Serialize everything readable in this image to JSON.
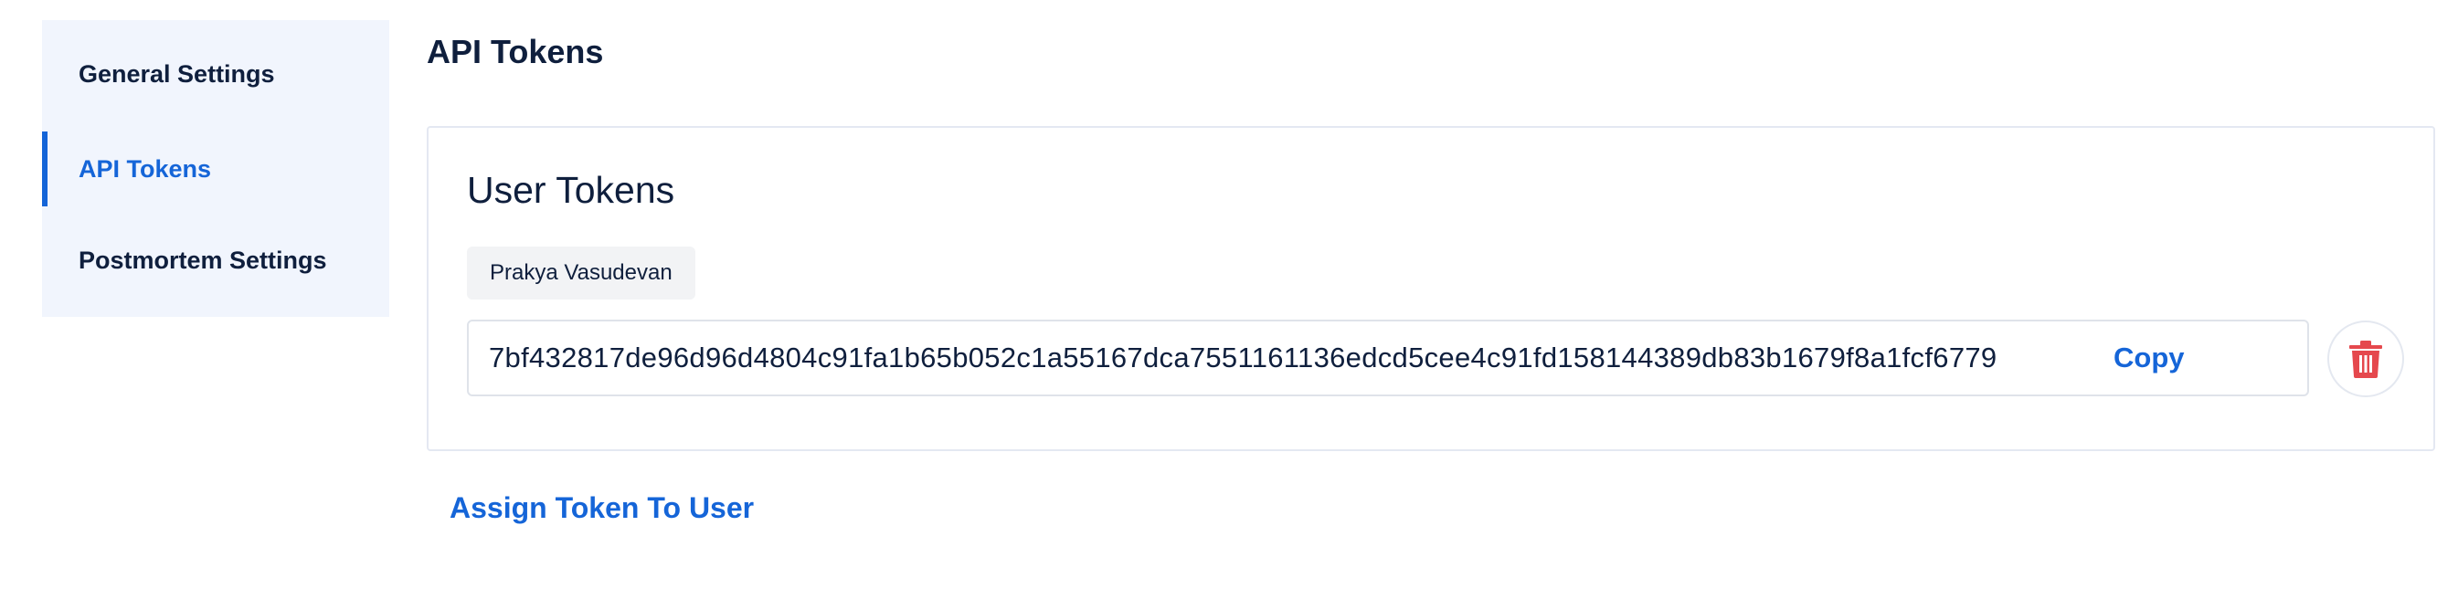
{
  "sidebar": {
    "items": [
      {
        "label": "General Settings",
        "active": false
      },
      {
        "label": "API Tokens",
        "active": true
      },
      {
        "label": "Postmortem Settings",
        "active": false
      }
    ]
  },
  "main": {
    "title": "API Tokens",
    "card": {
      "title": "User Tokens",
      "user_name": "Prakya Vasudevan",
      "token_value": "7bf432817de96d96d4804c91fa1b65b052c1a55167dca7551161136edcd5cee4c91fd158144389db83b1679f8a1fcf6779",
      "copy_label": "Copy",
      "delete_icon": "trash-icon"
    },
    "assign_link_label": "Assign Token To User"
  },
  "colors": {
    "accent": "#1565d8",
    "sidebar_bg": "#f1f5fd",
    "text": "#0f1f3d",
    "danger": "#e5484d"
  }
}
